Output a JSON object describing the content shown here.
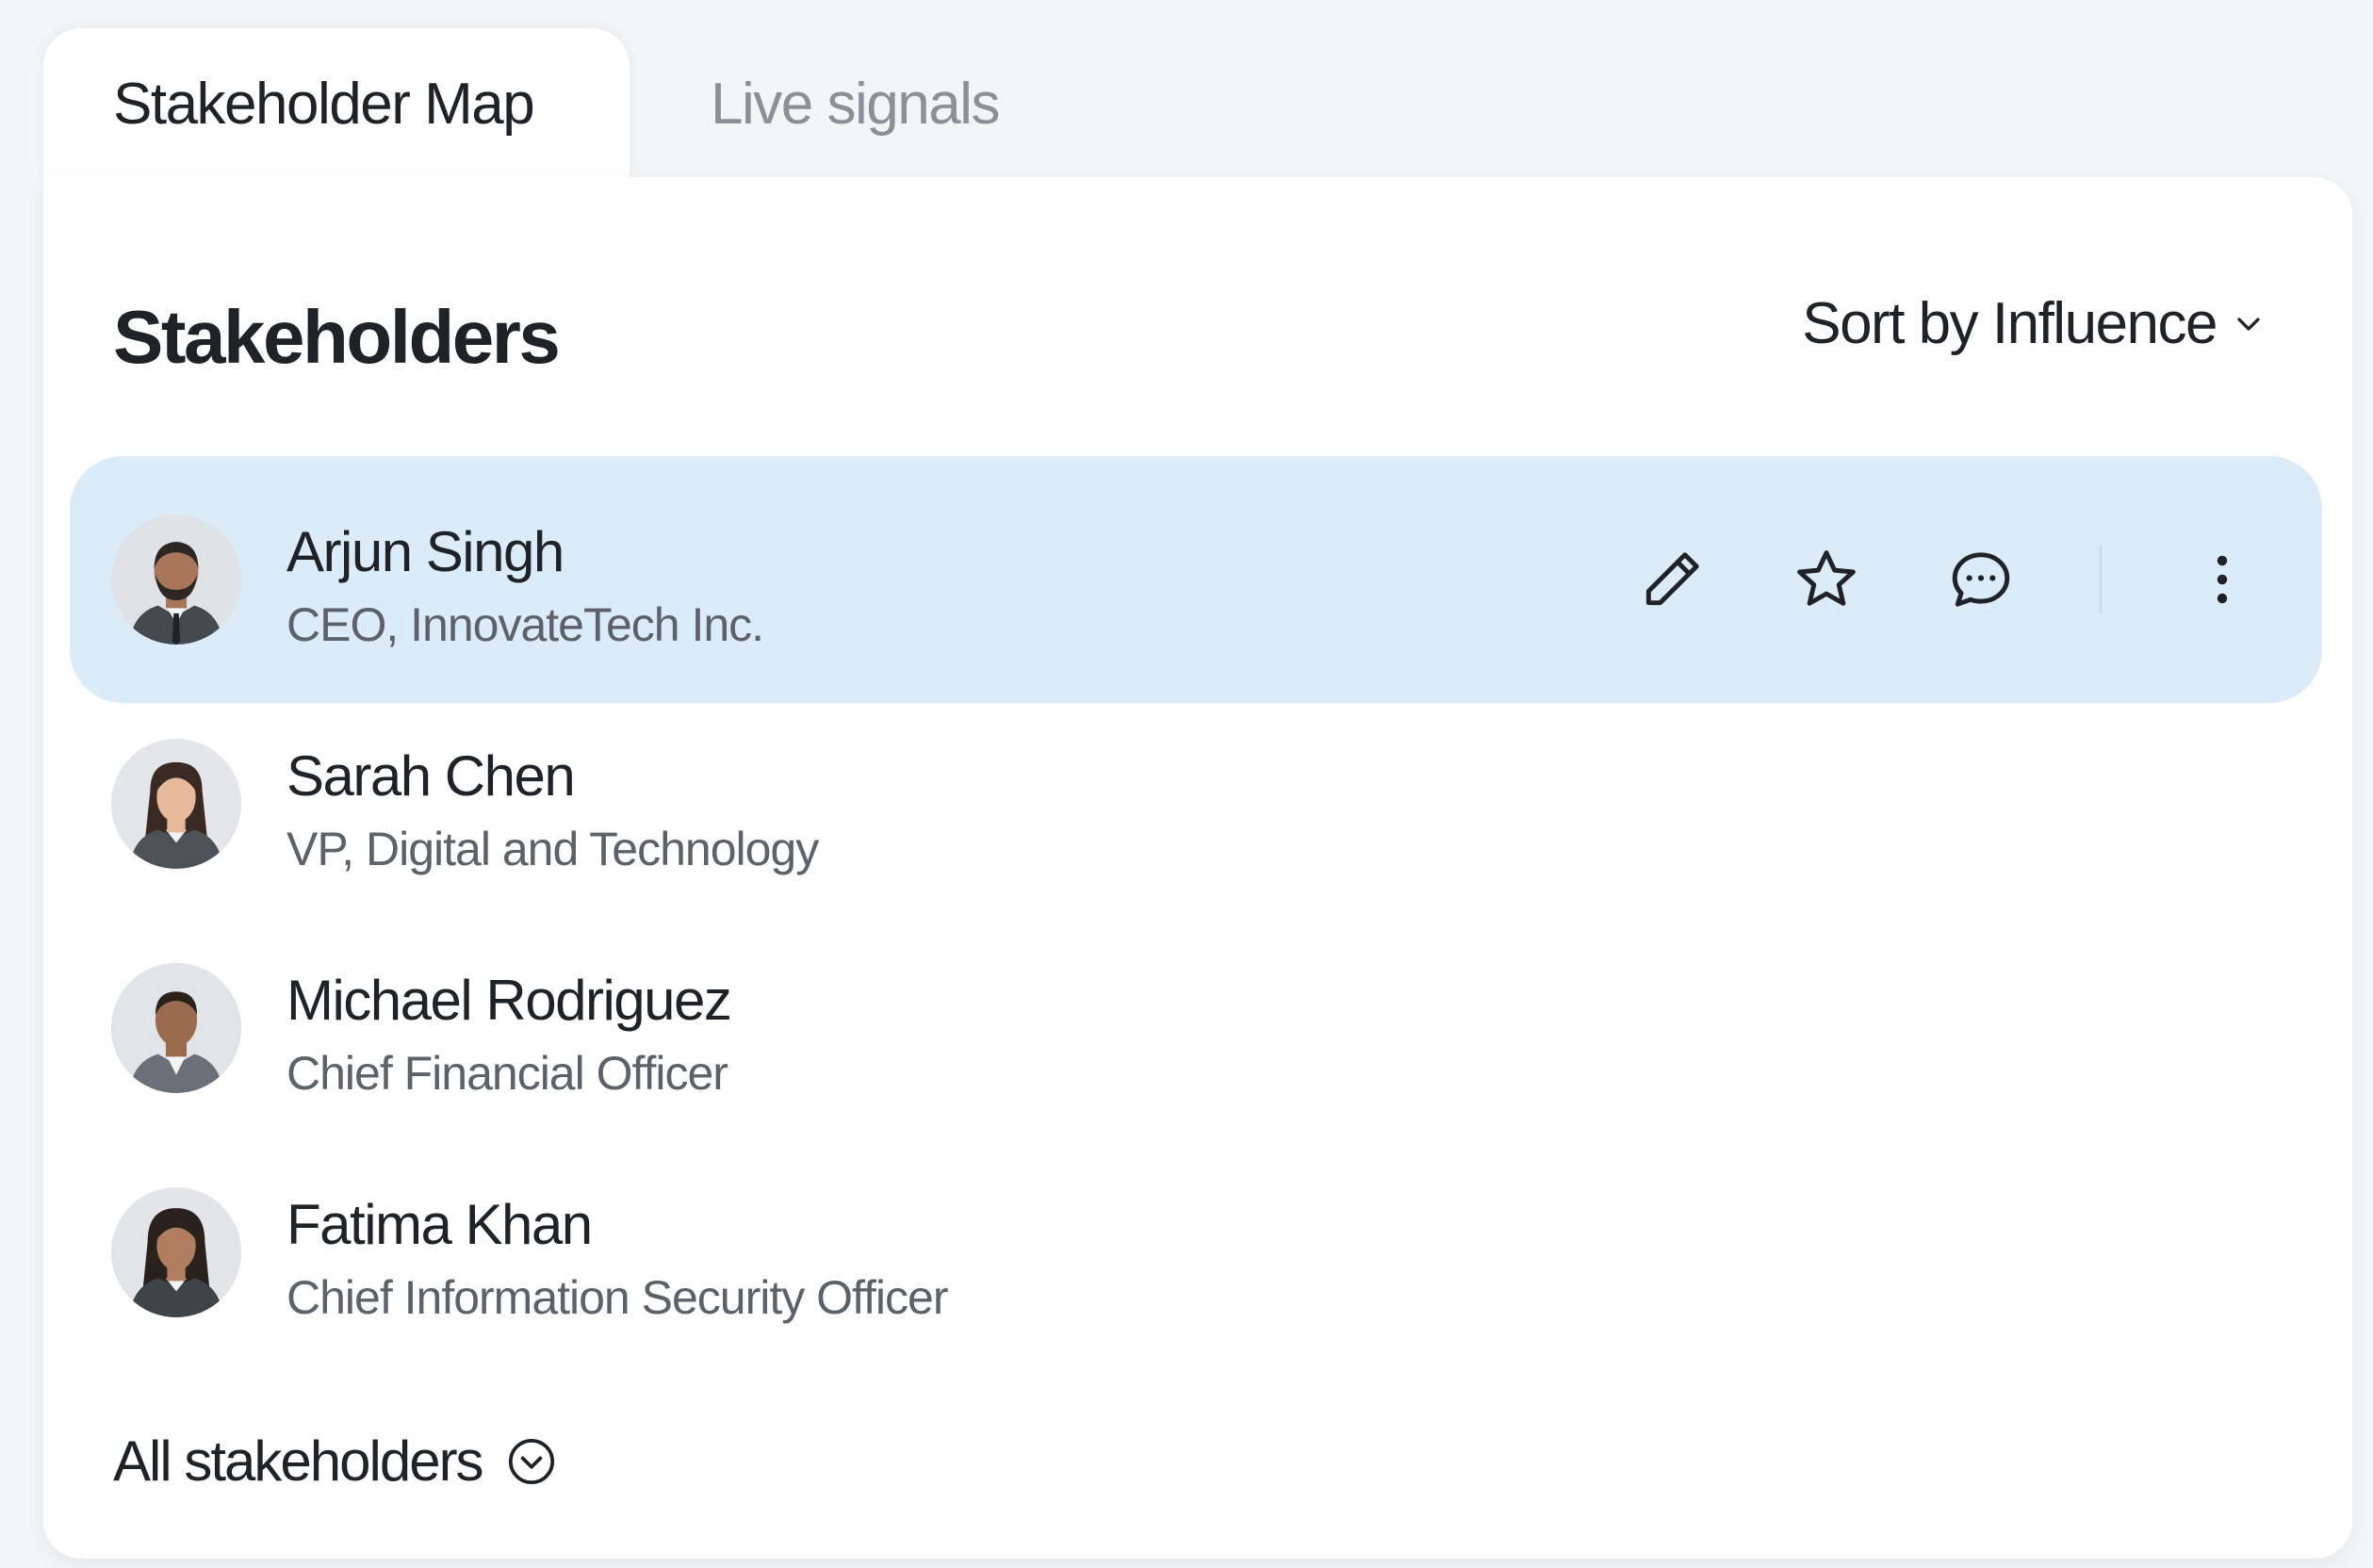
{
  "tabs": [
    {
      "label": "Stakeholder Map",
      "active": true
    },
    {
      "label": "Live signals",
      "active": false
    }
  ],
  "section": {
    "title": "Stakeholders",
    "sort_label": "Sort by Influence",
    "sort_icon": "chevron-down-icon"
  },
  "stakeholders": [
    {
      "name": "Arjun Singh",
      "title": "CEO, InnovateTech Inc.",
      "selected": true,
      "skin": "#a8775a",
      "hair": "#2e2622",
      "beard": true,
      "gender": "male"
    },
    {
      "name": "Sarah Chen",
      "title": "VP, Digital and Technology",
      "selected": false,
      "skin": "#e8b89a",
      "hair": "#3a2a24",
      "beard": false,
      "gender": "female"
    },
    {
      "name": "Michael Rodriguez",
      "title": "Chief Financial Officer",
      "selected": false,
      "skin": "#9a6b4e",
      "hair": "#2a211d",
      "beard": false,
      "gender": "male"
    },
    {
      "name": "Fatima Khan",
      "title": "Chief Information Security Officer",
      "selected": false,
      "skin": "#b07e5e",
      "hair": "#2a201c",
      "beard": false,
      "gender": "female"
    }
  ],
  "row_actions": {
    "icons": [
      "pencil-icon",
      "star-icon",
      "chat-icon",
      "more-vertical-icon"
    ]
  },
  "footer": {
    "label": "All stakeholders",
    "icon": "chevron-circle-down-icon"
  },
  "colors": {
    "selected_row": "#dcebf8",
    "text_primary": "#1f2328",
    "text_secondary": "#5d6168",
    "inactive_tab": "#8d9096"
  }
}
